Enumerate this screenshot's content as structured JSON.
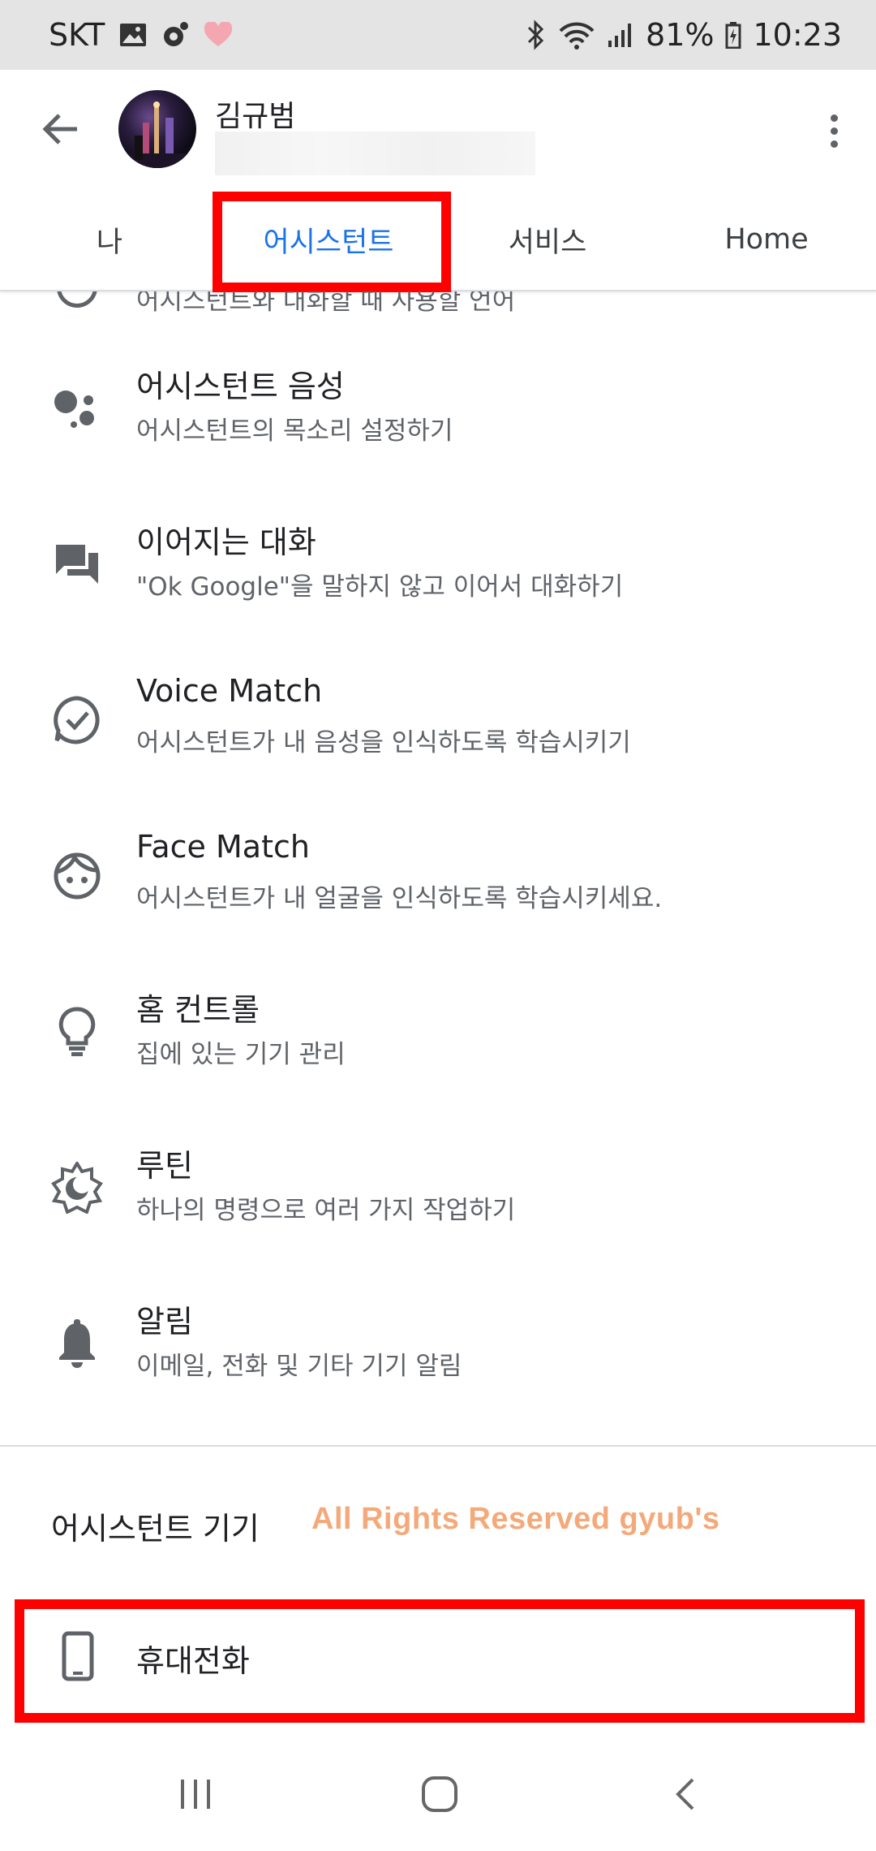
{
  "status_bar": {
    "carrier": "SKT",
    "battery": "81%",
    "time": "10:23"
  },
  "header": {
    "user_name": "김규범"
  },
  "tabs": [
    {
      "label": "나"
    },
    {
      "label": "어시스턴트"
    },
    {
      "label": "서비스"
    },
    {
      "label": "Home"
    }
  ],
  "partial_row": {
    "subtitle": "어시스턴트와 대화할 때 사용할 언어"
  },
  "settings": [
    {
      "title": "어시스턴트 음성",
      "subtitle": "어시스턴트의 목소리 설정하기",
      "icon": "assistant-dots-icon"
    },
    {
      "title": "이어지는 대화",
      "subtitle": "\"Ok Google\"을 말하지 않고 이어서 대화하기",
      "icon": "chat-icon"
    },
    {
      "title": "Voice Match",
      "subtitle": "어시스턴트가 내 음성을 인식하도록 학습시키기",
      "icon": "voice-match-icon"
    },
    {
      "title": "Face Match",
      "subtitle": "어시스턴트가 내 얼굴을 인식하도록 학습시키세요.",
      "icon": "face-icon"
    },
    {
      "title": "홈 컨트롤",
      "subtitle": "집에 있는 기기 관리",
      "icon": "lightbulb-icon"
    },
    {
      "title": "루틴",
      "subtitle": "하나의 명령으로 여러 가지 작업하기",
      "icon": "routine-icon"
    },
    {
      "title": "알림",
      "subtitle": "이메일, 전화 및 기타 기기 알림",
      "icon": "bell-icon"
    }
  ],
  "devices_section": {
    "title": "어시스턴트 기기",
    "watermark": "All Rights Reserved gyub's",
    "devices": [
      {
        "label": "휴대전화",
        "icon": "phone-icon"
      }
    ]
  },
  "colors": {
    "accent": "#1a73e8",
    "highlight_box": "#ff0000",
    "watermark": "#f4a97a"
  }
}
